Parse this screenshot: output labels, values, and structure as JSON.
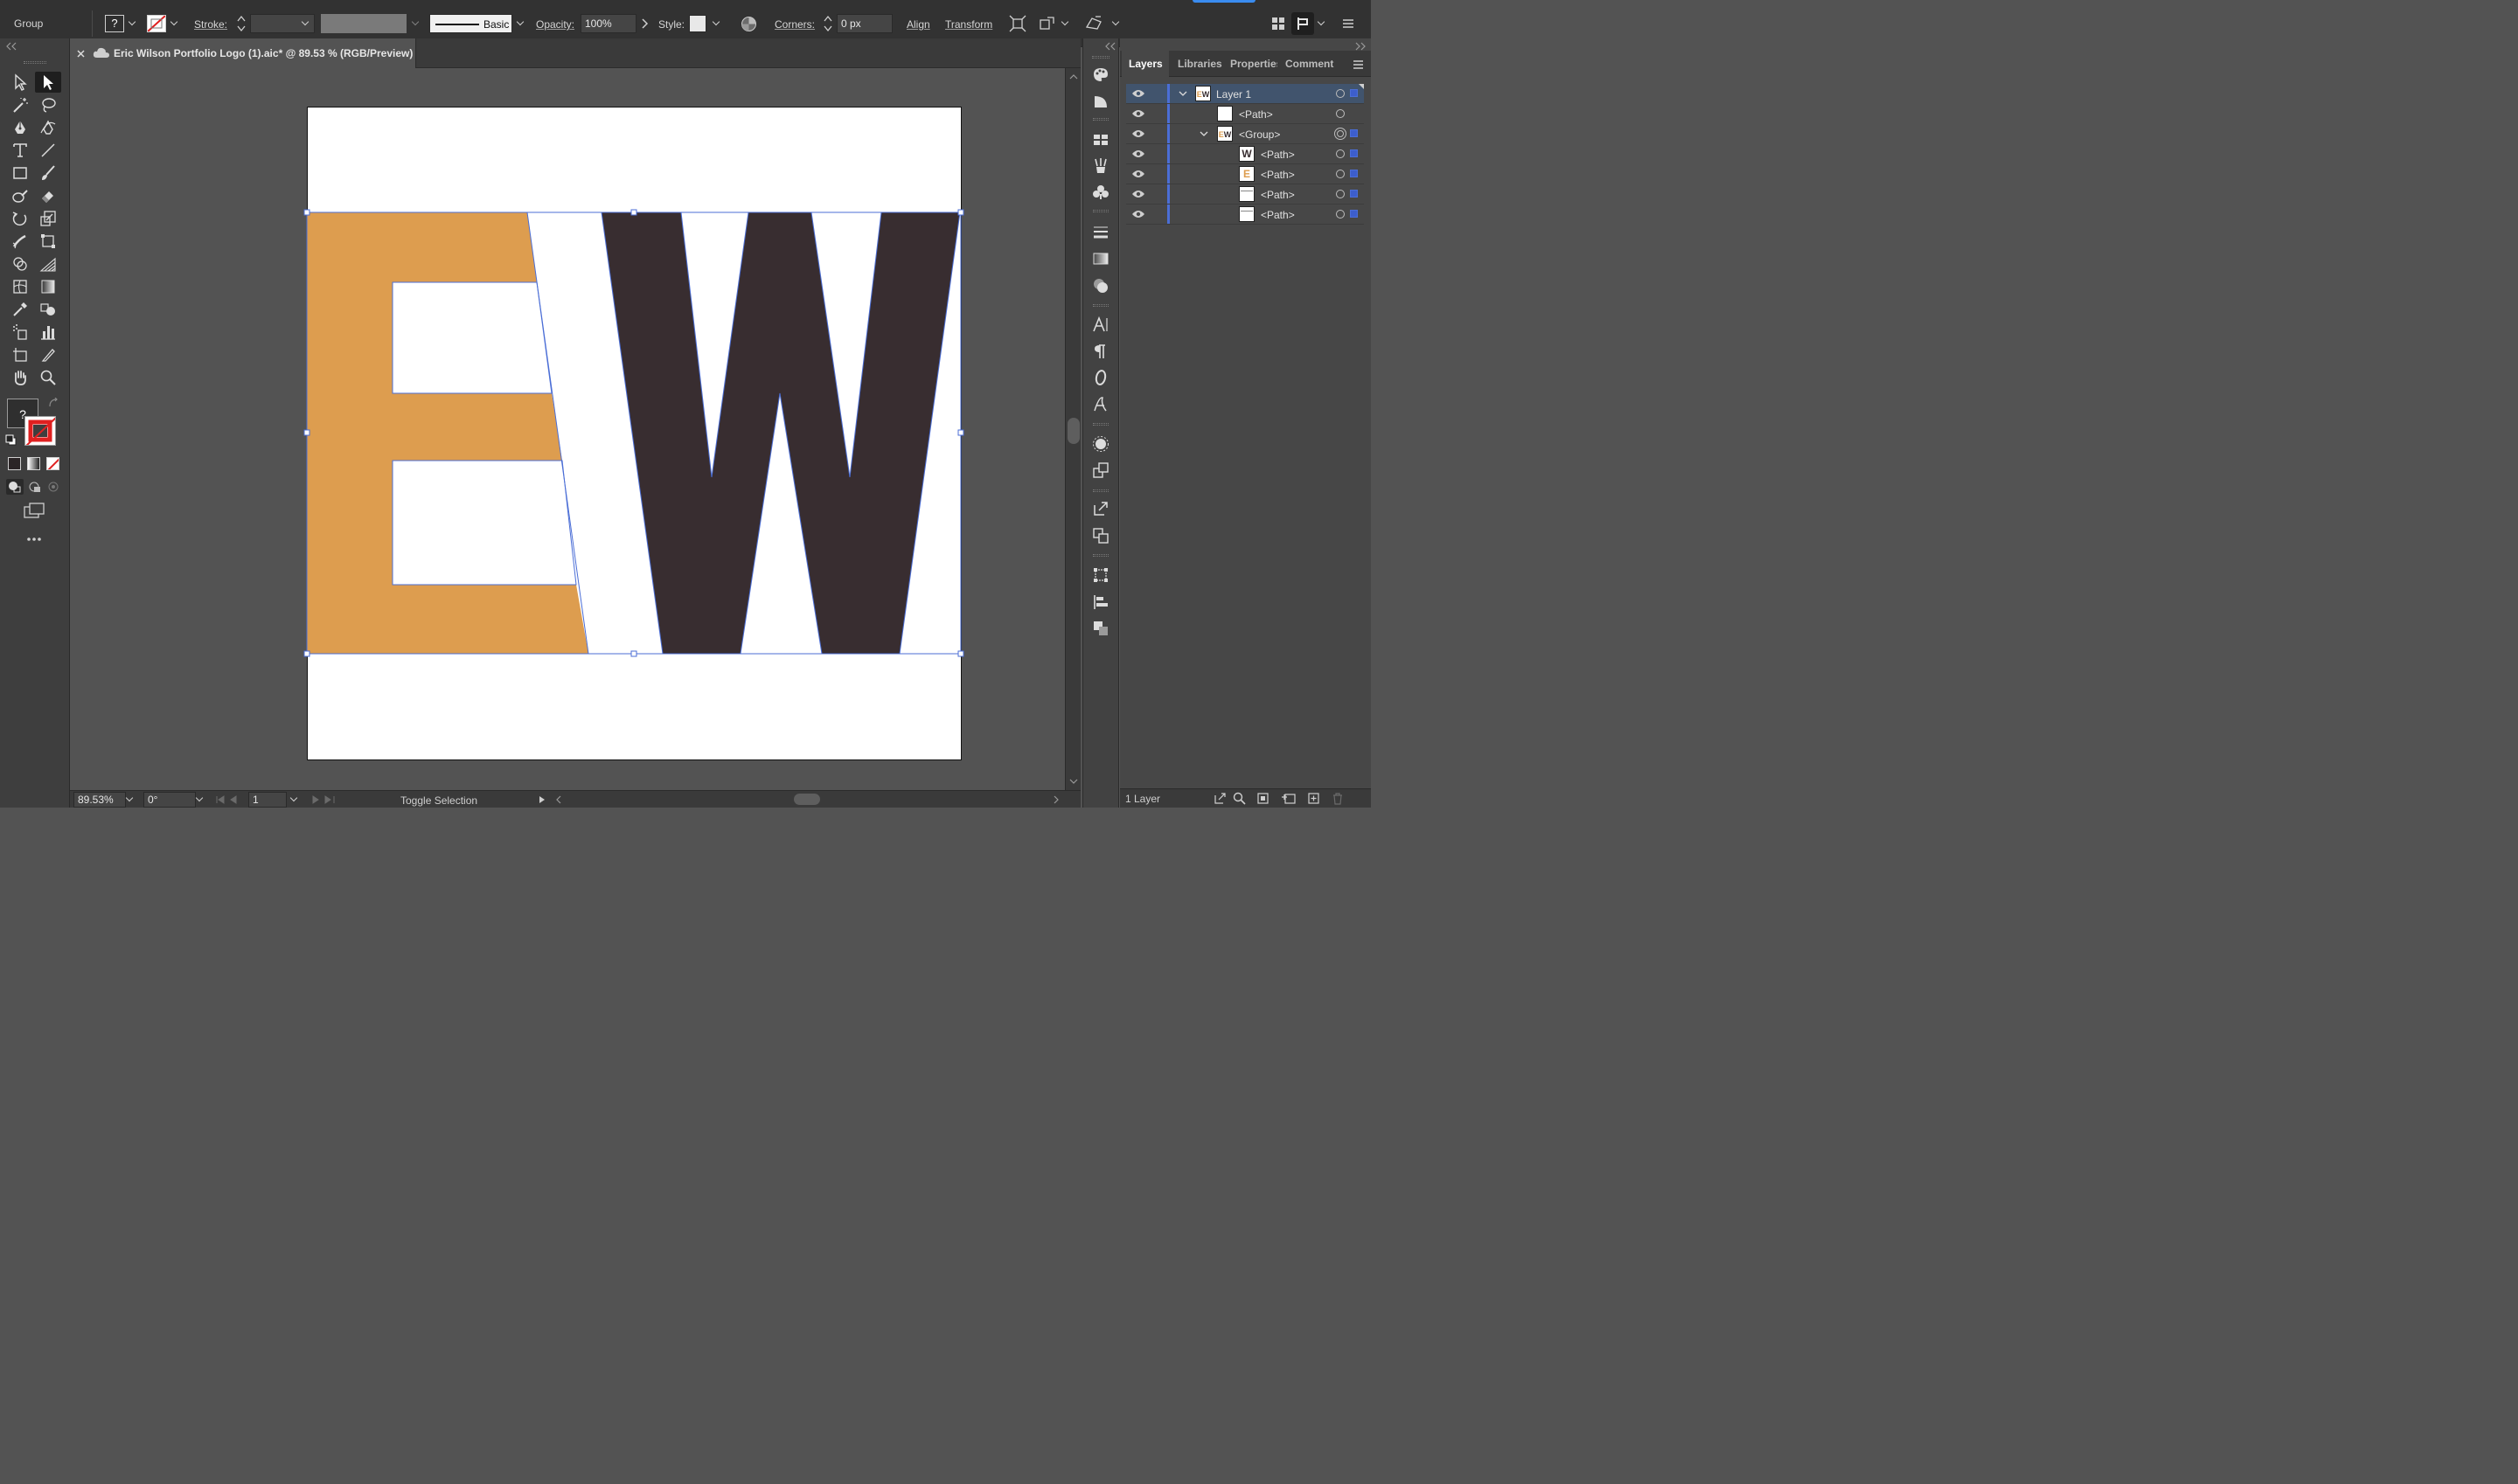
{
  "control_bar": {
    "selection_type": "Group",
    "fill_unknown": "?",
    "stroke_label": "Stroke:",
    "stroke_profile_label": "Basic",
    "opacity_label": "Opacity:",
    "opacity_value": "100%",
    "style_label": "Style:",
    "corners_label": "Corners:",
    "corners_value": "0 px",
    "align_label": "Align",
    "transform_label": "Transform"
  },
  "document_tab": {
    "title": "Eric Wilson Portfolio Logo (1).aic* @ 89.53 % (RGB/Preview)"
  },
  "toolbar": {
    "fill_unknown": "?"
  },
  "artwork": {
    "letter_e_color": "#dd9d4f",
    "letter_w_color": "#382d30",
    "selection_color": "#4b6ed6",
    "artboard_color": "#ffffff"
  },
  "status_bar": {
    "zoom": "89.53%",
    "rotation": "0°",
    "artboard_number": "1",
    "status_text": "Toggle Selection"
  },
  "layers_panel": {
    "tabs": [
      "Layers",
      "Libraries",
      "Properties",
      "Comment"
    ],
    "rows": [
      {
        "name": "Layer 1",
        "thumb": "EW"
      },
      {
        "name": "<Path>",
        "thumb": ""
      },
      {
        "name": "<Group>",
        "thumb": "EW"
      },
      {
        "name": "<Path>",
        "thumb": "W"
      },
      {
        "name": "<Path>",
        "thumb": "E"
      },
      {
        "name": "<Path>",
        "thumb": ""
      },
      {
        "name": "<Path>",
        "thumb": ""
      }
    ],
    "footer_count": "1 Layer"
  }
}
